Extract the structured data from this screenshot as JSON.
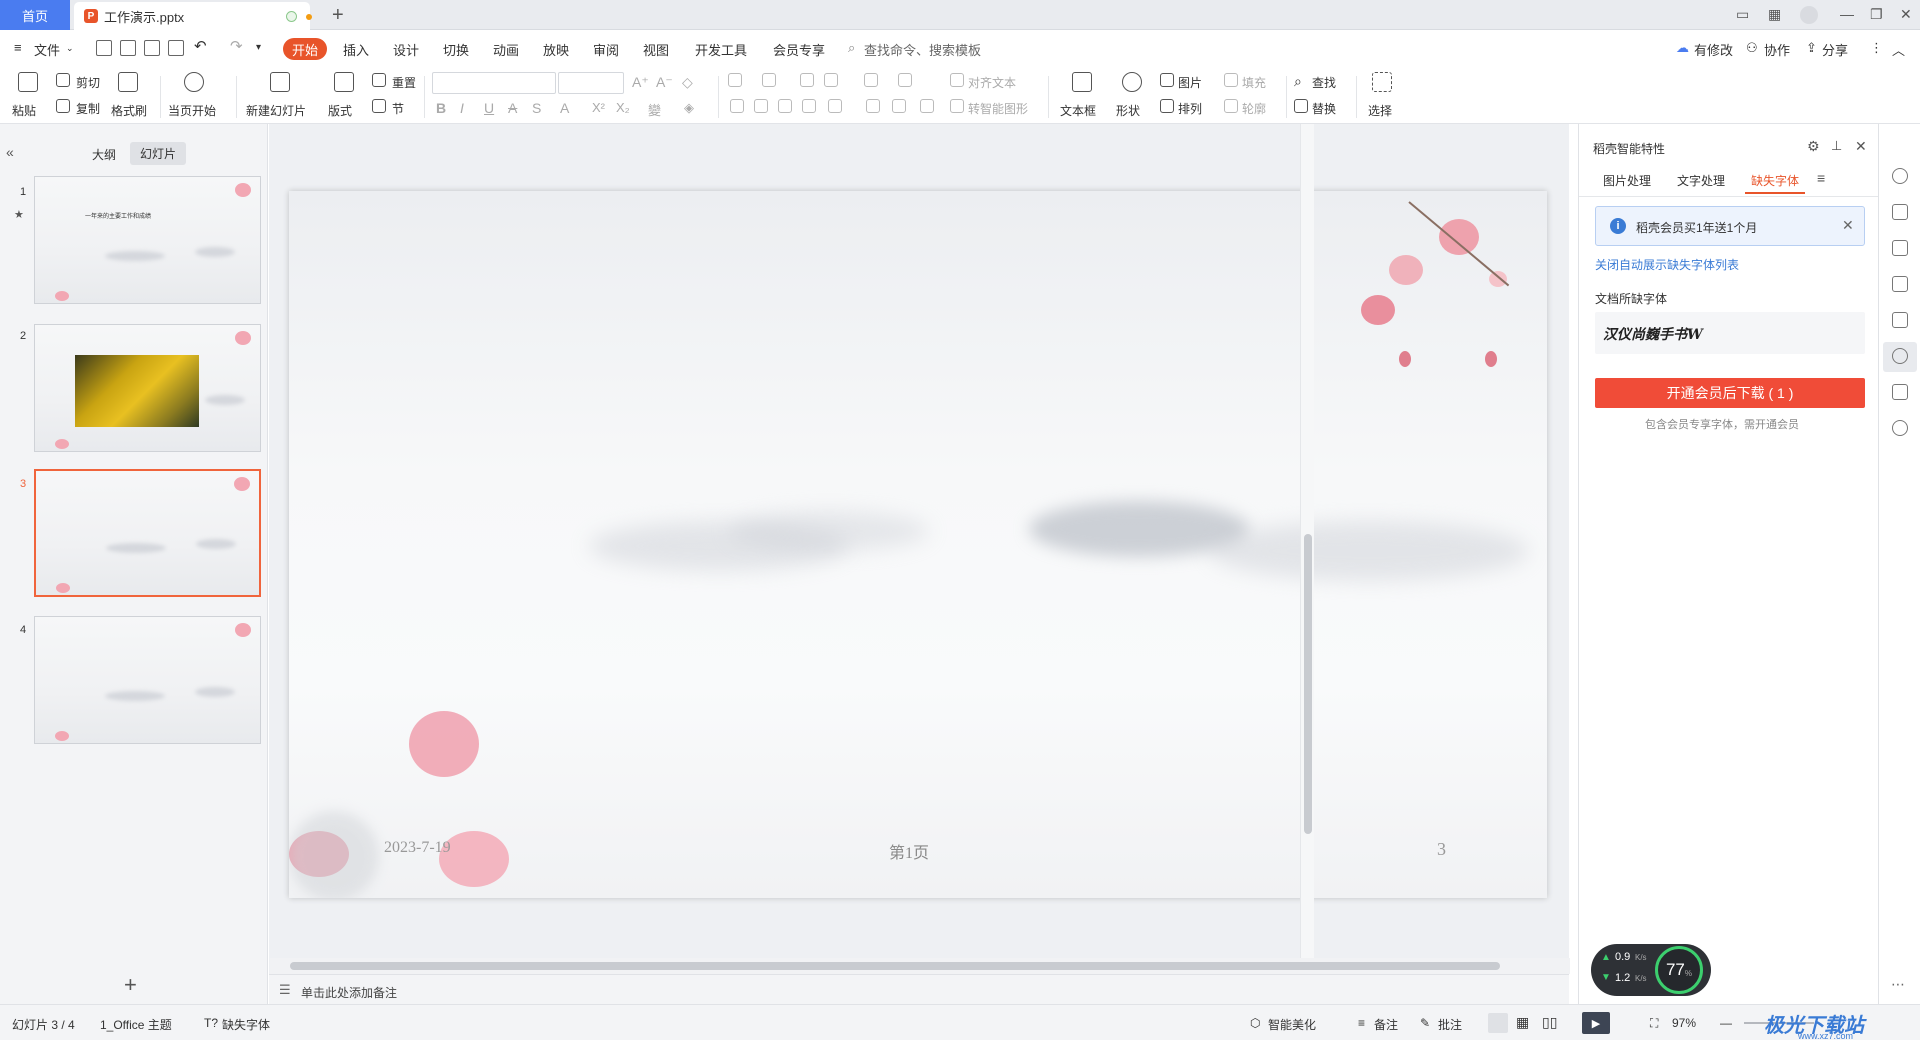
{
  "titlebar": {
    "home_tab": "首页",
    "doc_tab": "工作演示.pptx",
    "ppt_badge": "P"
  },
  "menubar": {
    "file": "文件",
    "tabs": [
      "开始",
      "插入",
      "设计",
      "切换",
      "动画",
      "放映",
      "审阅",
      "视图",
      "开发工具",
      "会员专享"
    ],
    "search_placeholder": "查找命令、搜索模板",
    "has_changes": "有修改",
    "collaborate": "协作",
    "share": "分享"
  },
  "ribbon": {
    "paste": "粘贴",
    "cut": "剪切",
    "copy": "复制",
    "format_painter": "格式刷",
    "from_start": "当页开始",
    "new_slide": "新建幻灯片",
    "layout": "版式",
    "reset": "重置",
    "section": "节",
    "align_text": "对齐文本",
    "smart_shape": "转智能图形",
    "textbox": "文本框",
    "shape": "形状",
    "picture": "图片",
    "fill": "填充",
    "arrange": "排列",
    "outline": "轮廓",
    "find": "查找",
    "replace": "替换",
    "select": "选择"
  },
  "leftpane": {
    "outline_tab": "大纲",
    "slides_tab": "幻灯片",
    "slides": [
      {
        "num": "1",
        "title": "一年来的主要工作和成绩"
      },
      {
        "num": "2",
        "title": ""
      },
      {
        "num": "3",
        "title": ""
      },
      {
        "num": "4",
        "title": ""
      }
    ],
    "add": "+"
  },
  "slide": {
    "date": "2023-7-19",
    "footer": "第1页",
    "number": "3"
  },
  "notes": {
    "placeholder": "单击此处添加备注"
  },
  "rightpane": {
    "title": "稻壳智能特性",
    "tabs": [
      "图片处理",
      "文字处理",
      "缺失字体"
    ],
    "promo": "稻壳会员买1年送1个月",
    "close_auto": "关闭自动展示缺失字体列表",
    "missing_label": "文档所缺字体",
    "font_name": "汉仪尚巍手书W",
    "download_button": "开通会员后下载 ( 1 )",
    "hint": "包含会员专享字体，需开通会员"
  },
  "speed_widget": {
    "up": "0.9",
    "down": "1.2",
    "unit": "K/s",
    "percent": "77",
    "percent_unit": "%"
  },
  "statusbar": {
    "slide_info": "幻灯片 3 / 4",
    "theme": "1_Office 主题",
    "missing_font": "缺失字体",
    "beautify": "智能美化",
    "notes": "备注",
    "comments": "批注",
    "zoom": "97%",
    "watermark": "极光下载站",
    "watermark_url": "www.xz7.com"
  },
  "colors": {
    "accent": "#e8542a",
    "home_blue": "#4a7cf0",
    "link_blue": "#3a7bd5",
    "download_red": "#f04c38"
  }
}
